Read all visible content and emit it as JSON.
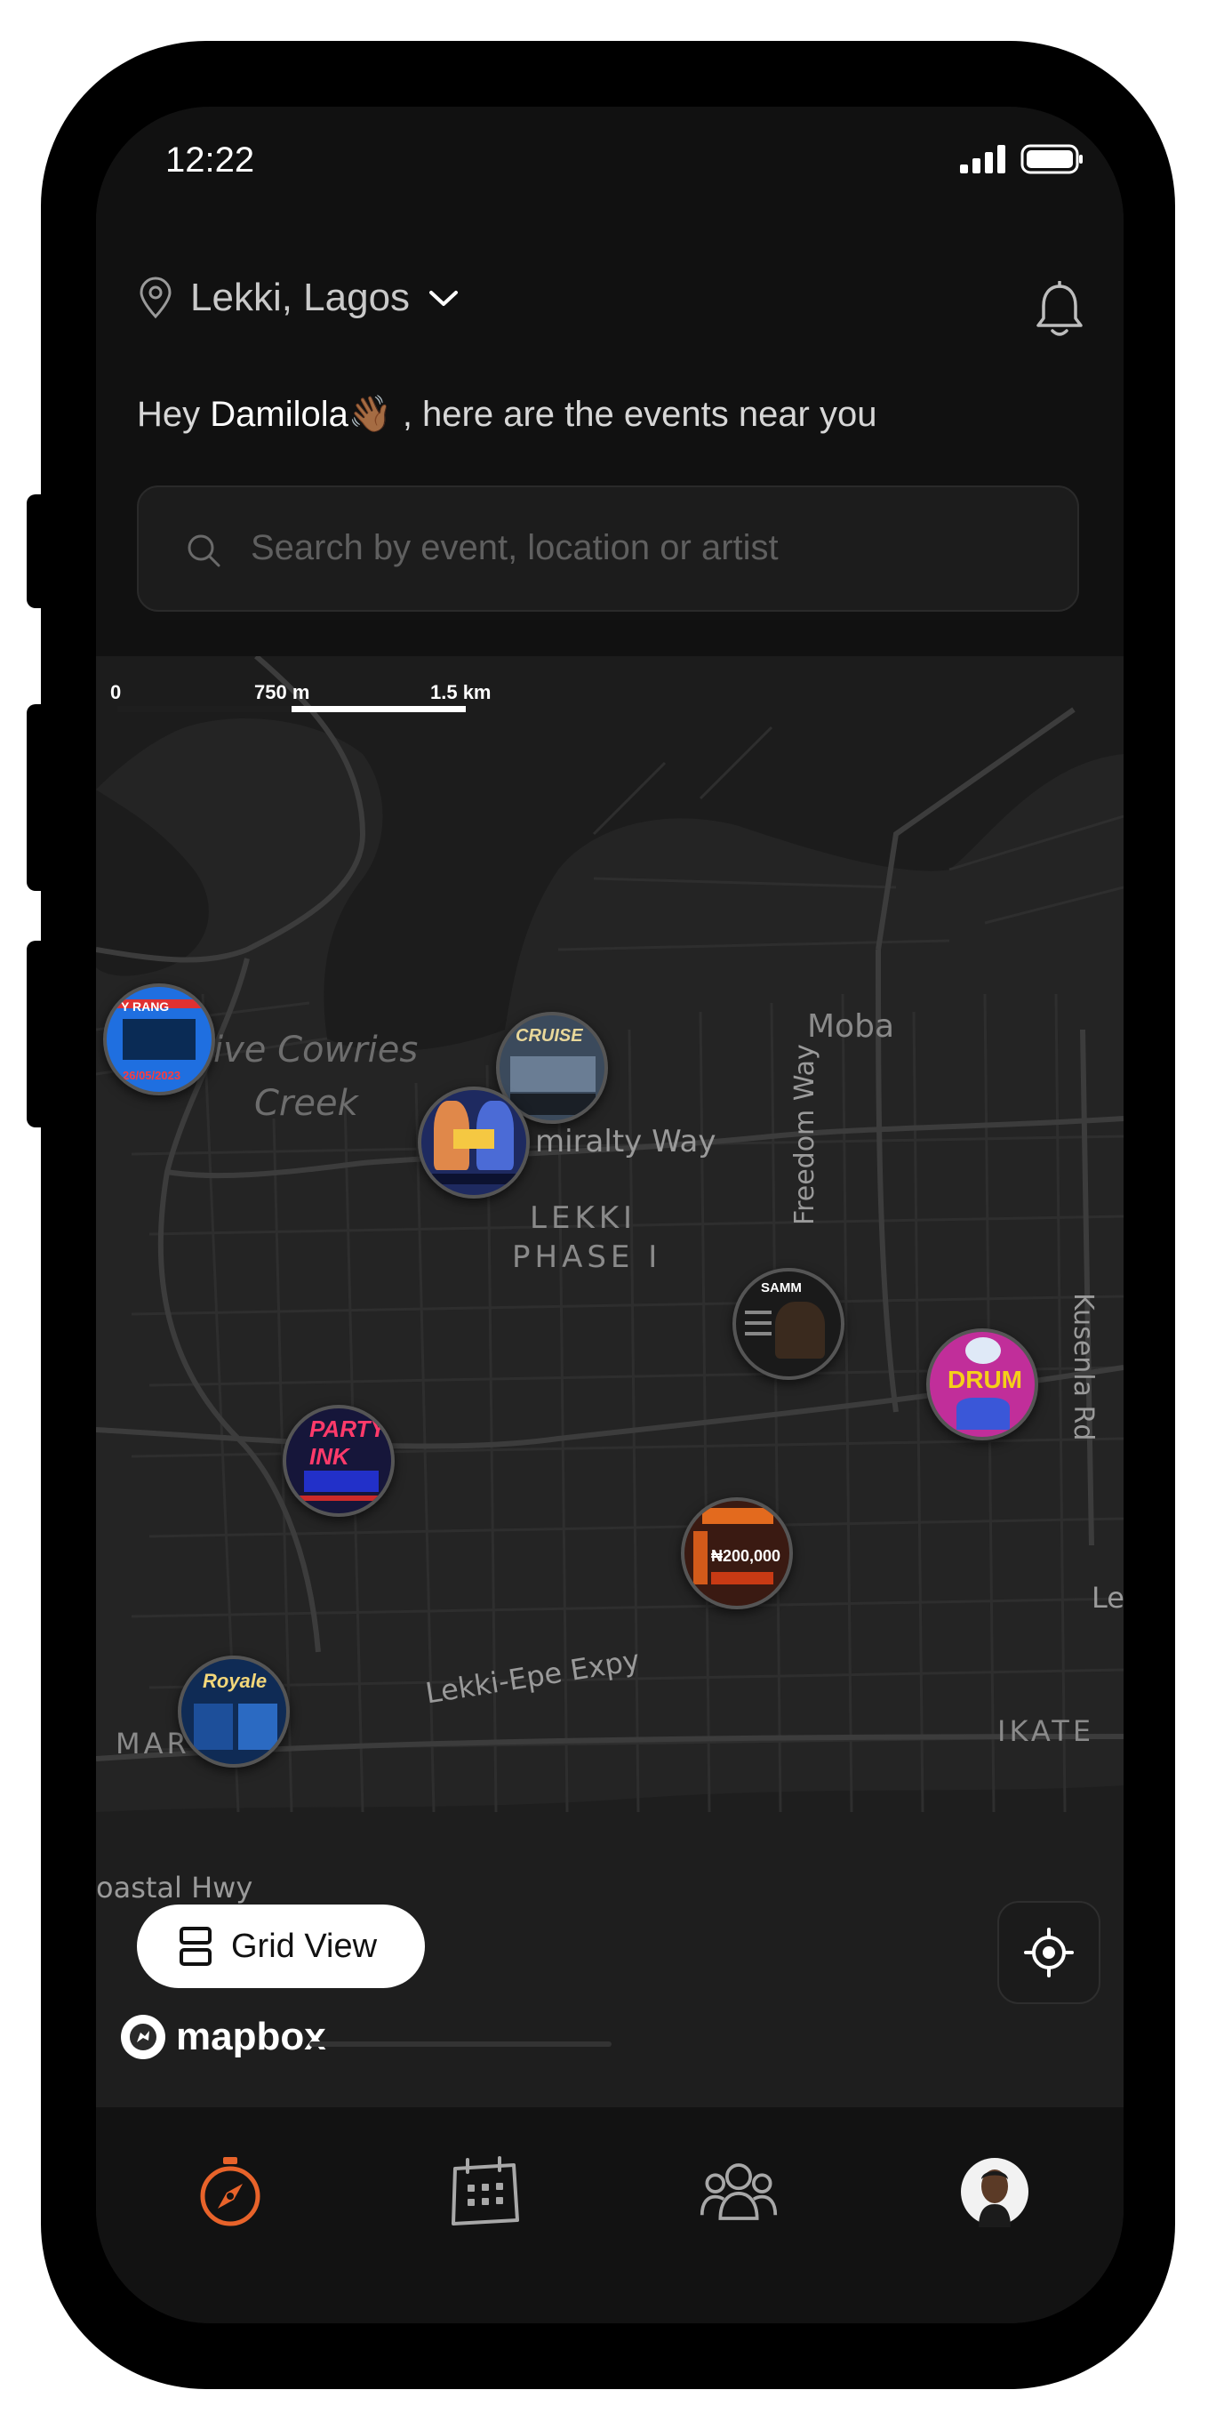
{
  "status_bar": {
    "time": "12:22"
  },
  "header": {
    "location": "Lekki, Lagos",
    "greeting_prefix": "Hey",
    "user_name": "Damilola👋🏾",
    "greeting_suffix": ", here are the events near you"
  },
  "search": {
    "placeholder": "Search by event, location or artist"
  },
  "map": {
    "scale": {
      "zero": "0",
      "mid": "750 m",
      "max": "1.5 km"
    },
    "labels": {
      "creek_1": "ive Cowries",
      "creek_2": "Creek",
      "moba": "Moba",
      "admiralty": "miralty Way",
      "lekki_1": "LEKKI",
      "lekki_2": "PHASE I",
      "freedom": "Freedom Way",
      "kusenla": "Kusenla Rd",
      "lekki_epe": "Lekki-Epe Expy",
      "le": "Le",
      "ikate": "IKATE",
      "mar": "MAR",
      "coastal": "oastal Hwy"
    },
    "pins": [
      {
        "label": "Y RANG",
        "date": "26/05/2023"
      },
      {
        "label": "CRUISE"
      },
      {
        "label": ""
      },
      {
        "label": "SAMM"
      },
      {
        "label": "DRUM"
      },
      {
        "label": "PARTY INK"
      },
      {
        "label": "₦200,000"
      },
      {
        "label": "Royale"
      }
    ]
  },
  "controls": {
    "grid_view": "Grid View",
    "attribution": "mapbox"
  },
  "tabbar": {
    "active_color": "#e8632a",
    "items": [
      "compass-icon",
      "calendar-icon",
      "community-icon",
      "profile-avatar"
    ]
  }
}
